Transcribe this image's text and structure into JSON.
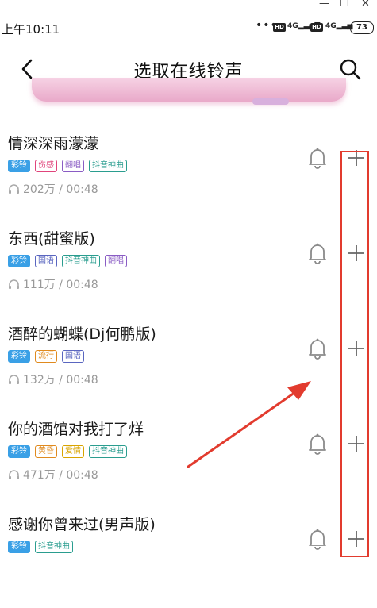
{
  "status_bar": {
    "time": "上午10:11",
    "network1": "4G",
    "network2": "4G",
    "hd1": "HD",
    "hd2": "HD",
    "battery": "73"
  },
  "header": {
    "title": "选取在线铃声",
    "back_icon": "back-arrow-icon",
    "search_icon": "search-icon"
  },
  "songs": [
    {
      "name": "情深深雨濛濛",
      "tags": [
        "彩铃",
        "伤感",
        "翻唱",
        "抖音神曲"
      ],
      "plays": "202万",
      "duration": "00:48"
    },
    {
      "name": "东西(甜蜜版)",
      "tags": [
        "彩铃",
        "国语",
        "抖音神曲",
        "翻唱"
      ],
      "plays": "111万",
      "duration": "00:48"
    },
    {
      "name": "酒醉的蝴蝶(Dj何鹏版)",
      "tags": [
        "彩铃",
        "流行",
        "国语"
      ],
      "plays": "132万",
      "duration": "00:48"
    },
    {
      "name": "你的酒馆对我打了烊",
      "tags": [
        "彩铃",
        "黄昏",
        "爱情",
        "抖音神曲"
      ],
      "plays": "471万",
      "duration": "00:48"
    },
    {
      "name": "感谢你曾来过(男声版)",
      "tags": [
        "彩铃",
        "抖音神曲"
      ],
      "plays": "",
      "duration": ""
    }
  ],
  "colors": {
    "tag_caling": "#3aa0e6",
    "highlight_box": "#e23b2e",
    "banner": "#e9a9c9"
  }
}
